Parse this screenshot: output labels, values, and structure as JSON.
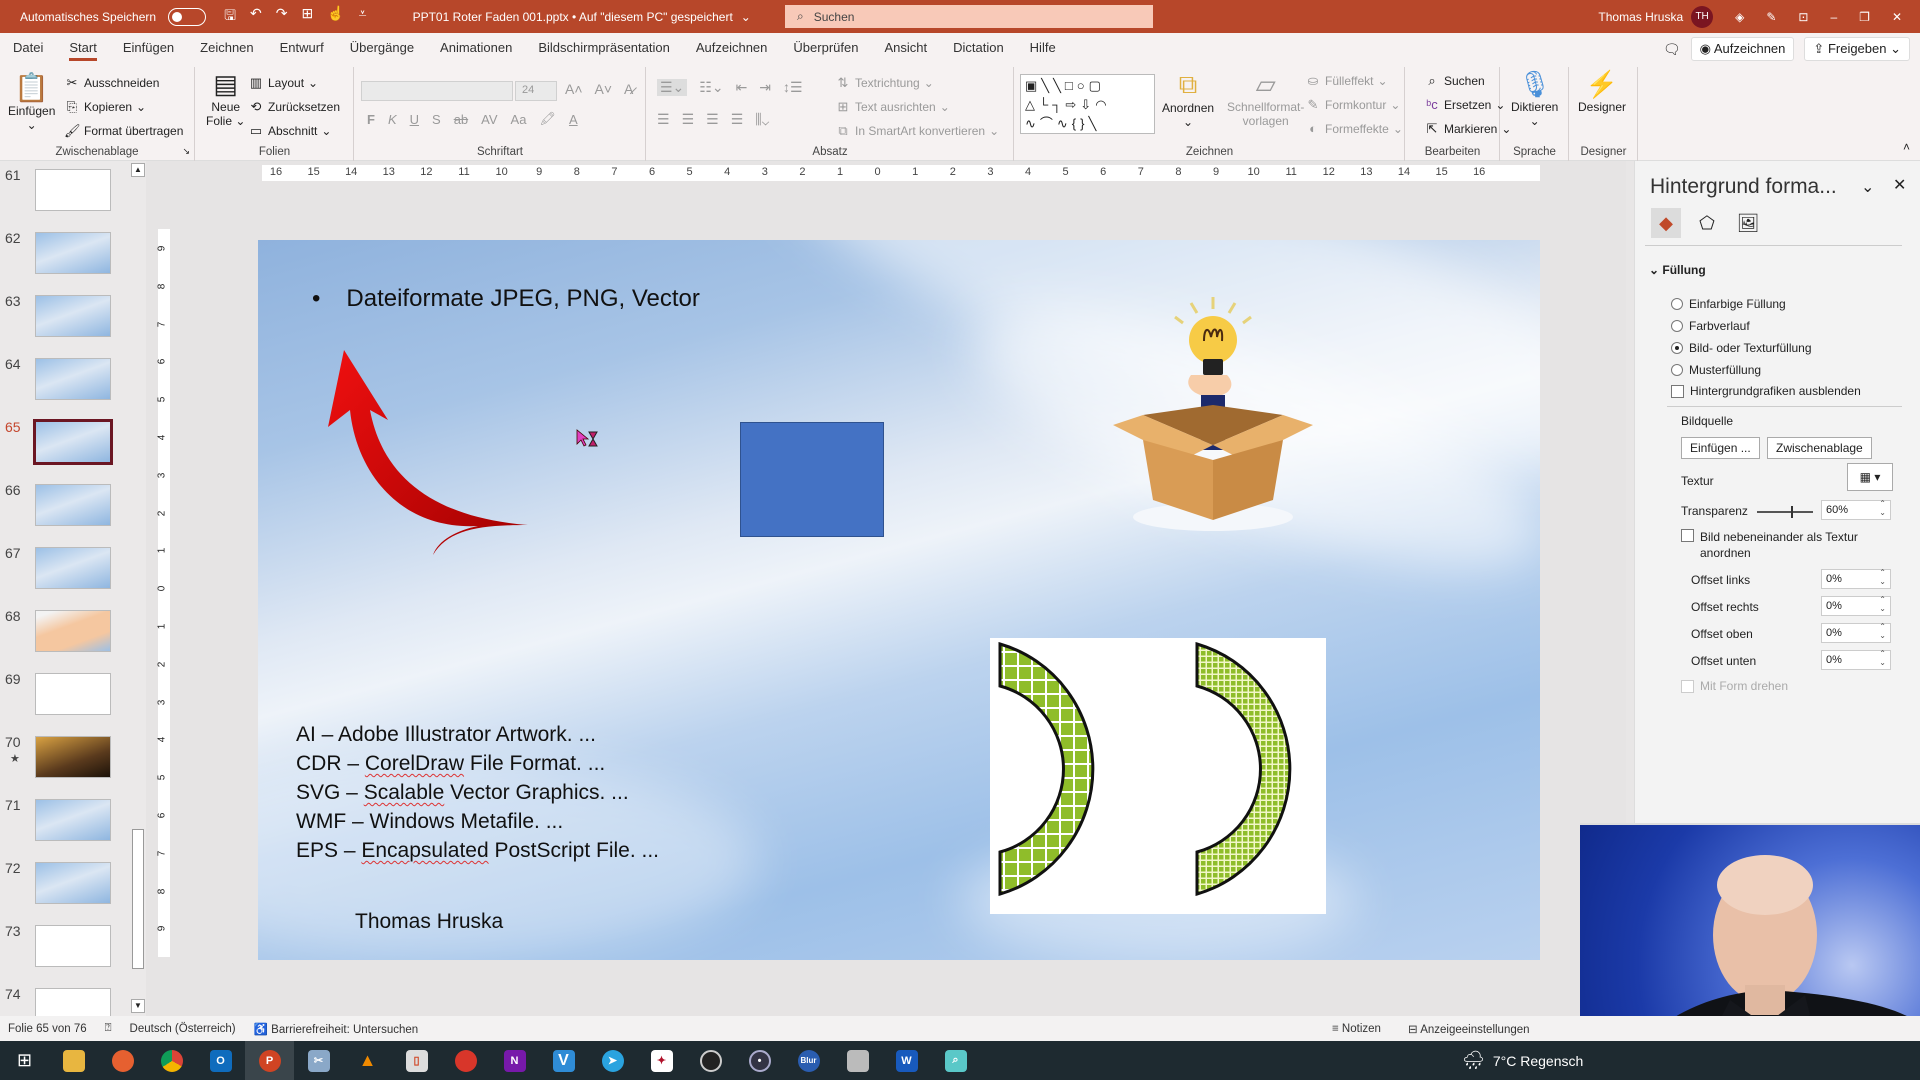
{
  "titlebar": {
    "autosave_label": "Automatisches Speichern",
    "document_title": "PPT01 Roter Faden 001.pptx • Auf \"diesem PC\" gespeichert",
    "search_placeholder": "Suchen",
    "user_name": "Thomas Hruska",
    "user_initials": "TH"
  },
  "menu": {
    "tabs": [
      "Datei",
      "Start",
      "Einfügen",
      "Zeichnen",
      "Entwurf",
      "Übergänge",
      "Animationen",
      "Bildschirmpräsentation",
      "Aufzeichnen",
      "Überprüfen",
      "Ansicht",
      "Dictation",
      "Hilfe"
    ],
    "active_tab": "Start",
    "record_button": "Aufzeichnen",
    "share_button": "Freigeben"
  },
  "ribbon": {
    "clipboard": {
      "label": "Zwischenablage",
      "paste": "Einfügen",
      "cut": "Ausschneiden",
      "copy": "Kopieren",
      "format_painter": "Format übertragen"
    },
    "slides": {
      "label": "Folien",
      "new_slide_1": "Neue",
      "new_slide_2": "Folie",
      "layout": "Layout",
      "reset": "Zurücksetzen",
      "section": "Abschnitt"
    },
    "font": {
      "label": "Schriftart",
      "font_name": "",
      "font_size": "24",
      "bold": "F",
      "italic": "K",
      "underline": "U",
      "shadow": "S",
      "strike": "ab",
      "spacing": "AV",
      "case": "Aa"
    },
    "paragraph": {
      "label": "Absatz",
      "text_direction": "Textrichtung",
      "align_text": "Text ausrichten",
      "smartart": "In SmartArt konvertieren"
    },
    "drawing": {
      "label": "Zeichnen",
      "arrange": "Anordnen",
      "quick_styles_1": "Schnellformat-",
      "quick_styles_2": "vorlagen",
      "shape_fill": "Fülleffekt",
      "shape_outline": "Formkontur",
      "shape_effects": "Formeffekte"
    },
    "editing": {
      "label": "Bearbeiten",
      "find": "Suchen",
      "replace": "Ersetzen",
      "select": "Markieren"
    },
    "voice": {
      "label": "Sprache",
      "dictate": "Diktieren"
    },
    "designer": {
      "label": "Designer",
      "button": "Designer"
    }
  },
  "slides_panel": {
    "slides": [
      {
        "num": "61",
        "style": "white"
      },
      {
        "num": "62",
        "style": "sky"
      },
      {
        "num": "63",
        "style": "sky"
      },
      {
        "num": "64",
        "style": "sky"
      },
      {
        "num": "65",
        "style": "sky",
        "selected": true
      },
      {
        "num": "66",
        "style": "sky"
      },
      {
        "num": "67",
        "style": "sky"
      },
      {
        "num": "68",
        "style": "peach"
      },
      {
        "num": "69",
        "style": "white"
      },
      {
        "num": "70",
        "style": "dark",
        "star": true
      },
      {
        "num": "71",
        "style": "sky"
      },
      {
        "num": "72",
        "style": "sky"
      },
      {
        "num": "73",
        "style": "white"
      },
      {
        "num": "74",
        "style": "white"
      }
    ]
  },
  "rulers": {
    "horizontal": [
      "16",
      "15",
      "14",
      "13",
      "12",
      "11",
      "10",
      "9",
      "8",
      "7",
      "6",
      "5",
      "4",
      "3",
      "2",
      "1",
      "0",
      "1",
      "2",
      "3",
      "4",
      "5",
      "6",
      "7",
      "8",
      "9",
      "10",
      "11",
      "12",
      "13",
      "14",
      "15",
      "16"
    ],
    "vertical": [
      "9",
      "8",
      "7",
      "6",
      "5",
      "4",
      "3",
      "2",
      "1",
      "0",
      "1",
      "2",
      "3",
      "4",
      "5",
      "6",
      "7",
      "8",
      "9"
    ]
  },
  "slide": {
    "bullet": "Dateiformate JPEG, PNG, Vector",
    "formats": [
      {
        "prefix": "AI – ",
        "word": "Adobe Illustrator Artwork. ...",
        "spell": ""
      },
      {
        "prefix": "CDR – ",
        "spell": "CorelDraw",
        "word": " File Format. ..."
      },
      {
        "prefix": "SVG – ",
        "spell": "Scalable",
        "word": " Vector Graphics. ..."
      },
      {
        "prefix": "WMF – ",
        "word": "Windows Metafile. ...",
        "spell": ""
      },
      {
        "prefix": "EPS – ",
        "spell": "Encapsulated",
        "word": " PostScript File. ..."
      }
    ],
    "author": "Thomas Hruska",
    "colors": {
      "arrow": "#d40f0f",
      "square": "#4472c4",
      "crescent": "#8fbd2a"
    }
  },
  "format_panel": {
    "title": "Hintergrund forma...",
    "section": "Füllung",
    "fill_options": [
      {
        "label": "Einfarbige Füllung",
        "checked": false
      },
      {
        "label": "Farbverlauf",
        "checked": false
      },
      {
        "label": "Bild- oder Texturfüllung",
        "checked": true
      },
      {
        "label": "Musterfüllung",
        "checked": false
      }
    ],
    "hide_graphics": "Hintergrundgrafiken ausblenden",
    "image_source": "Bildquelle",
    "insert_button": "Einfügen ...",
    "clipboard_button": "Zwischenablage",
    "texture_label": "Textur",
    "transparency_label": "Transparenz",
    "transparency_value": "60%",
    "transparency_fraction": 0.6,
    "tile_label_1": "Bild nebeneinander als Textur",
    "tile_label_2": "anordnen",
    "offsets": [
      {
        "label": "Offset links",
        "value": "0%"
      },
      {
        "label": "Offset rechts",
        "value": "0%"
      },
      {
        "label": "Offset oben",
        "value": "0%"
      },
      {
        "label": "Offset unten",
        "value": "0%"
      }
    ],
    "rotate_with_shape": "Mit Form drehen"
  },
  "statusbar": {
    "slide_info": "Folie 65 von 76",
    "language": "Deutsch (Österreich)",
    "accessibility": "Barrierefreiheit: Untersuchen",
    "notes": "Notizen",
    "display_settings": "Anzeigeeinstellungen"
  },
  "taskbar": {
    "weather": "7°C  Regensch"
  }
}
